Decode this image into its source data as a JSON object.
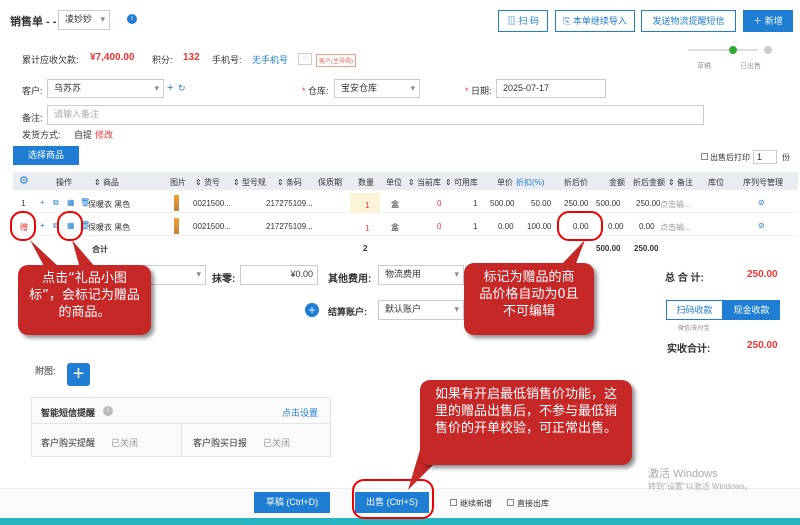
{
  "header": {
    "title": "销售单 - -",
    "user": "凌妙妙",
    "scan": "扫 码",
    "import": "本单继续导入",
    "sms": "发送物流提醒短信",
    "new": "新增"
  },
  "summary": {
    "debt_label": "累计应收欠款:",
    "debt": "¥7,400.00",
    "points_label": "积分:",
    "points": "132",
    "phone_label": "手机号:",
    "phone": "无手机号",
    "badge": "客户(主导购)"
  },
  "progress": {
    "draft": "草稿",
    "sold": "已出售"
  },
  "form": {
    "customer_label": "客户:",
    "customer": "乌苏苏",
    "warehouse_label": "仓库:",
    "warehouse": "宝安仓库",
    "date_label": "日期:",
    "date": "2025-07-17",
    "remark_label": "备注:",
    "remark_placeholder": "请输入备注",
    "ship_label": "发货方式:",
    "ship": "自提",
    "ship_edit": "修改"
  },
  "select_goods": "选择商品",
  "print_after": "出售后打印",
  "print_copies": "1",
  "print_unit": "份",
  "table": {
    "headers": [
      "操作",
      "商品",
      "图片",
      "货号",
      "型号规",
      "条码",
      "保质期",
      "数量",
      "单位",
      "当前库",
      "可用库",
      "单价",
      "折扣(%)",
      "折后价",
      "金额",
      "折后金额",
      "备注",
      "库位",
      "序列号管理"
    ],
    "rows": [
      {
        "idx": "1",
        "name": "保暖衣 黑色",
        "code": "0021500...",
        "barcode": "217275109...",
        "qty": "1",
        "unit": "盒",
        "stock": "0",
        "avail": "1",
        "price": "500.00",
        "disc": "50.00",
        "dprice": "250.00",
        "amt": "500.00",
        "damt": "250.00",
        "note": "点击输..."
      },
      {
        "idx": "赠",
        "name": "保暖衣 黑色",
        "code": "0021500...",
        "barcode": "217275109...",
        "qty": "1",
        "unit": "盒",
        "stock": "0",
        "avail": "1",
        "price": "0.00",
        "disc": "100.00",
        "dprice": "0.00",
        "amt": "0.00",
        "damt": "0.00",
        "note": "点击输..."
      }
    ],
    "total_label": "合计",
    "total_qty": "2",
    "total_amt": "500.00",
    "total_damt": "250.00"
  },
  "bottom": {
    "round_label": "抹零:",
    "round": "¥0.00",
    "other_fee_label": "其他费用:",
    "other_fee": "物流费用",
    "total_label": "总 合 计:",
    "total": "250.00",
    "account_label": "结算账户:",
    "account": "默认账户",
    "scan_pay": "扫码收款",
    "scan_pay_sub": "微信/支付宝",
    "cash_pay": "现金收款",
    "received_label": "实收合计:",
    "received": "250.00"
  },
  "attach_label": "附图:",
  "sms_box": {
    "title": "智能短信提醒",
    "setup": "点击设置",
    "buy_remind": "客户购买提醒",
    "buy_remind_state": "已关闭",
    "daily": "客户购买日报",
    "daily_state": "已关闭"
  },
  "footer": {
    "draft": "草稿 (Ctrl+D)",
    "sell": "出售 (Ctrl+S)",
    "continue": "继续新增",
    "direct": "直接出库"
  },
  "watermark": {
    "line1": "激活 Windows",
    "line2": "转到\"设置\"以激活 Windows。"
  },
  "callouts": {
    "c1": "点击“礼品小图标”，会标记为赠品的商品。",
    "c2": "标记为赠品的商品价格自动为0且不可编辑",
    "c3": "如果有开启最低销售价功能，这里的赠品出售后，不参与最低销售价的开单校验，可正常出售。"
  },
  "colors": {
    "accent": "#1f7ed3",
    "red": "#e33",
    "callout": "#c62828"
  }
}
